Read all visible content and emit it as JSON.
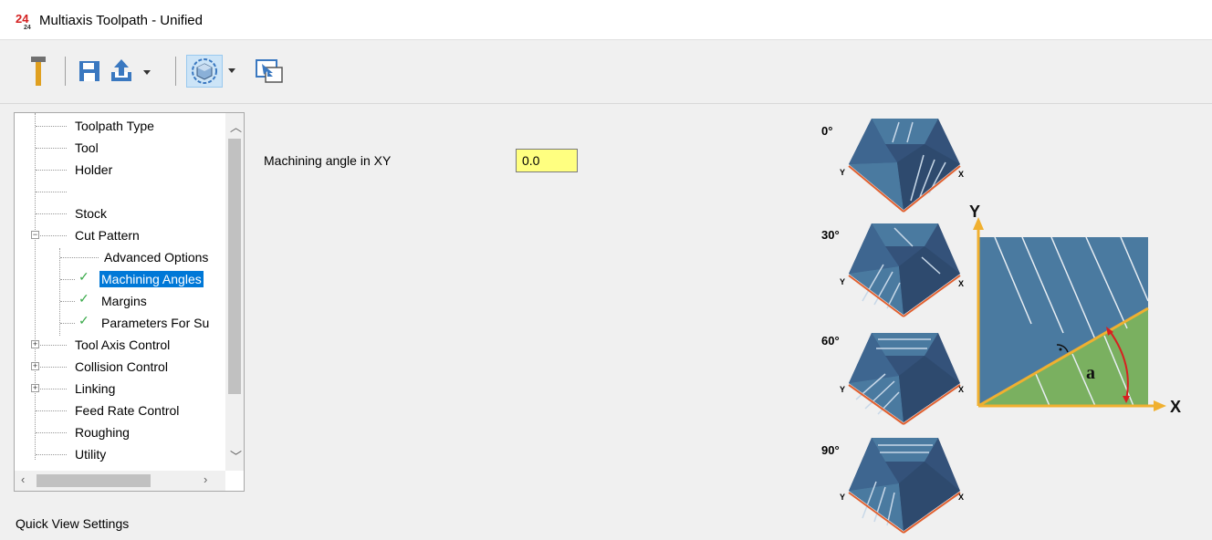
{
  "window": {
    "title": "Multiaxis Toolpath - Unified",
    "logo": "mastercam-logo"
  },
  "toolbar": {
    "buttons": [
      {
        "name": "tool-icon"
      },
      {
        "name": "save-icon"
      },
      {
        "name": "export-icon"
      },
      {
        "name": "view-icon",
        "active": true
      },
      {
        "name": "dock-icon"
      }
    ]
  },
  "tree": {
    "items": [
      {
        "label": "Toolpath Type",
        "level": 0
      },
      {
        "label": "Tool",
        "level": 0
      },
      {
        "label": "Holder",
        "level": 0
      },
      {
        "label": "",
        "level": 0
      },
      {
        "label": "Stock",
        "level": 0
      },
      {
        "label": "Cut Pattern",
        "level": 0,
        "expander": "minus"
      },
      {
        "label": "Advanced Options",
        "level": 1
      },
      {
        "label": "Machining Angles",
        "level": 1,
        "check": true,
        "selected": true
      },
      {
        "label": "Margins",
        "level": 1,
        "check": true
      },
      {
        "label": "Parameters For Su",
        "level": 1,
        "check": true
      },
      {
        "label": "Tool Axis Control",
        "level": 0,
        "expander": "plus"
      },
      {
        "label": "Collision Control",
        "level": 0,
        "expander": "plus"
      },
      {
        "label": "Linking",
        "level": 0,
        "expander": "plus"
      },
      {
        "label": "Feed Rate Control",
        "level": 0
      },
      {
        "label": "Roughing",
        "level": 0
      },
      {
        "label": "Utility",
        "level": 0
      }
    ]
  },
  "quick_view": {
    "label": "Quick View Settings"
  },
  "form": {
    "machining_angle_label": "Machining angle in XY",
    "machining_angle_value": "0.0"
  },
  "illustration": {
    "angles": [
      "0°",
      "30°",
      "60°",
      "90°"
    ],
    "axis_x_small": "X",
    "axis_y_small": "Y",
    "axis_x": "X",
    "axis_y": "Y",
    "angle_symbol": "a",
    "colors": {
      "face_light": "#4a7aa0",
      "face_dark": "#2e4a6e",
      "edge": "#e06030",
      "axis": "#f0b030",
      "green": "#7ab060"
    }
  }
}
